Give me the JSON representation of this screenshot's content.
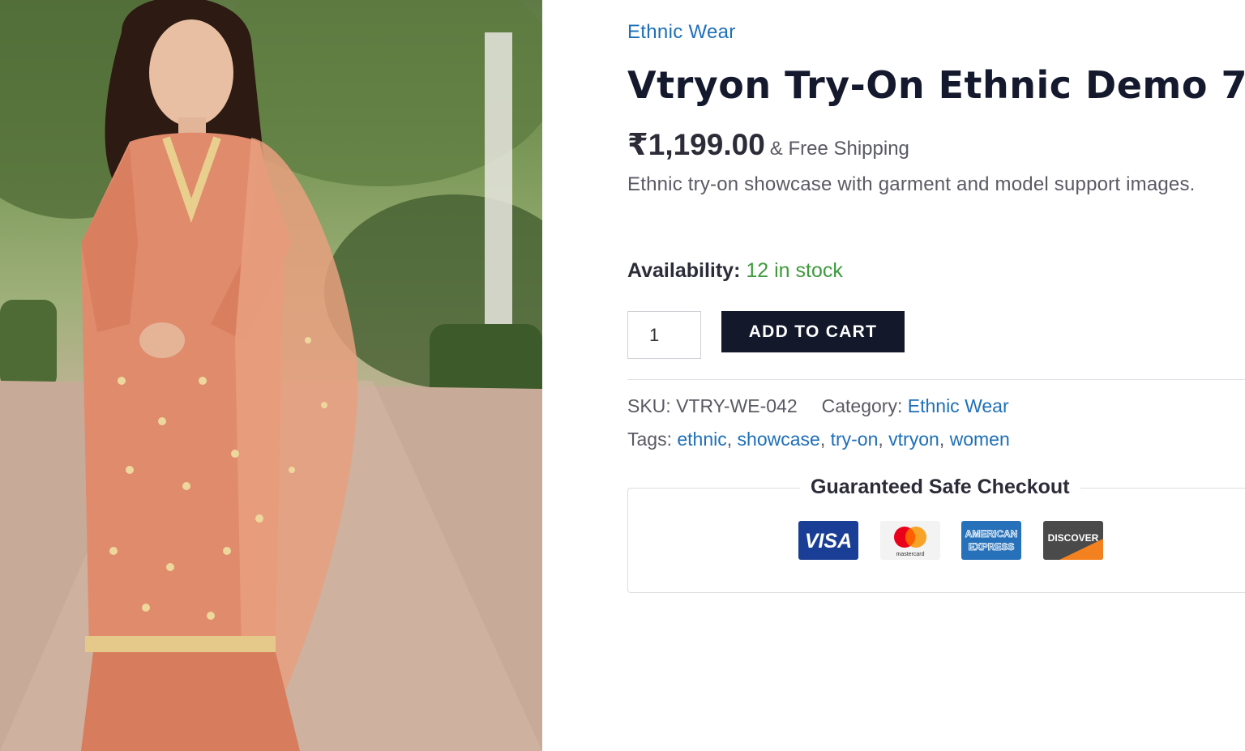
{
  "product": {
    "category_link": "Ethnic Wear",
    "title": "Vtryon Try-On Ethnic Demo 7",
    "price": "₹1,199.00",
    "shipping_note": "& Free Shipping",
    "short_description": "Ethnic try-on showcase with garment and model support images.",
    "availability_label": "Availability:",
    "availability_value": "12 in stock",
    "quantity": "1",
    "add_to_cart_label": "ADD TO CART"
  },
  "meta": {
    "sku_label": "SKU:",
    "sku_value": "VTRY-WE-042",
    "category_label": "Category:",
    "category_value": "Ethnic Wear",
    "tags_label": "Tags:",
    "tags": [
      "ethnic",
      "showcase",
      "try-on",
      "vtryon",
      "women"
    ],
    "tag_separator": ", "
  },
  "checkout": {
    "title": "Guaranteed Safe Checkout",
    "cards": [
      {
        "name": "visa",
        "label": "VISA",
        "icon": "visa-card-icon",
        "color": "#1a3e95"
      },
      {
        "name": "mastercard",
        "label": "mastercard",
        "icon": "mastercard-icon",
        "color": "#eb001b"
      },
      {
        "name": "amex",
        "label": "AMERICAN EXPRESS",
        "icon": "amex-card-icon",
        "color": "#2671b9"
      },
      {
        "name": "discover",
        "label": "DISCOVER",
        "icon": "discover-card-icon",
        "color": "#f48120"
      }
    ]
  },
  "colors": {
    "link": "#1e6fb8",
    "title": "#15192e",
    "button_bg": "#13192b",
    "in_stock": "#3d9a3d",
    "garment": "#e08b6c"
  }
}
